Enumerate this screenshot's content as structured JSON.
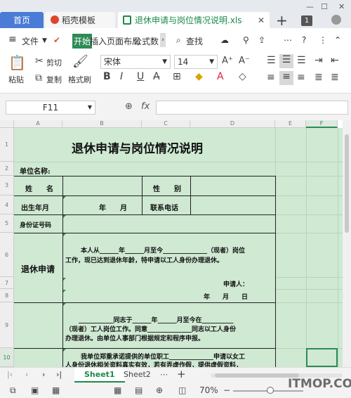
{
  "tabs": {
    "home": "首页",
    "daoke": "稻壳模板",
    "file": "退休申请与岗位情况说明.xls",
    "count": "1"
  },
  "menu": {
    "file": "文件",
    "start": "开始",
    "insert": "插入",
    "page_layout": "页面布局",
    "formula": "公式",
    "data": "数",
    "search": "查找"
  },
  "ribbon": {
    "paste": "粘贴",
    "cut": "剪切",
    "copy": "复制",
    "format_painter": "格式刷",
    "font_name": "宋体",
    "font_size": "14",
    "bold": "B",
    "italic": "I",
    "underline": "U"
  },
  "formula_bar": {
    "cell": "F11",
    "fx": "fx",
    "value": ""
  },
  "grid": {
    "columns": [
      "A",
      "B",
      "C",
      "D",
      "E",
      "F"
    ],
    "rows": [
      "1",
      "2",
      "3",
      "4",
      "5",
      "6",
      "7",
      "8",
      "9",
      "10",
      "11"
    ]
  },
  "form": {
    "title": "退休申请与岗位情况说明",
    "unit_name": "单位名称:",
    "name": "姓　　名",
    "gender": "性　　别",
    "birth": "出生年月",
    "year_month": "年　　月",
    "phone": "联系电话",
    "id_number": "身份证号码",
    "retire_apply": "退休申请",
    "apply_text_1": "本人从______年______月至今______________（现者）岗位",
    "apply_text_2": "工作，现已达到退休年龄，特申请以工人身份办理退休。",
    "applicant": "申请人：",
    "date": "年　　月　　日",
    "s2_line1": "___________同志于______年______月至今在__________",
    "s2_line2": "（现者）工人岗位工作。同意______________同志以工人身份",
    "s2_line3": "办理退休。由单位人事部门根据规定和程序申报。",
    "s3_line1": "我单位郑重承诺提供的单位职工______________申请以女工",
    "s3_line2": "人身份退休相关资料真实有效，若有弄虚作假，提供虚假资料，"
  },
  "sheets": [
    "Sheet1",
    "Sheet2"
  ],
  "status": {
    "zoom": "70%"
  },
  "watermark": "ITMOP.COM"
}
